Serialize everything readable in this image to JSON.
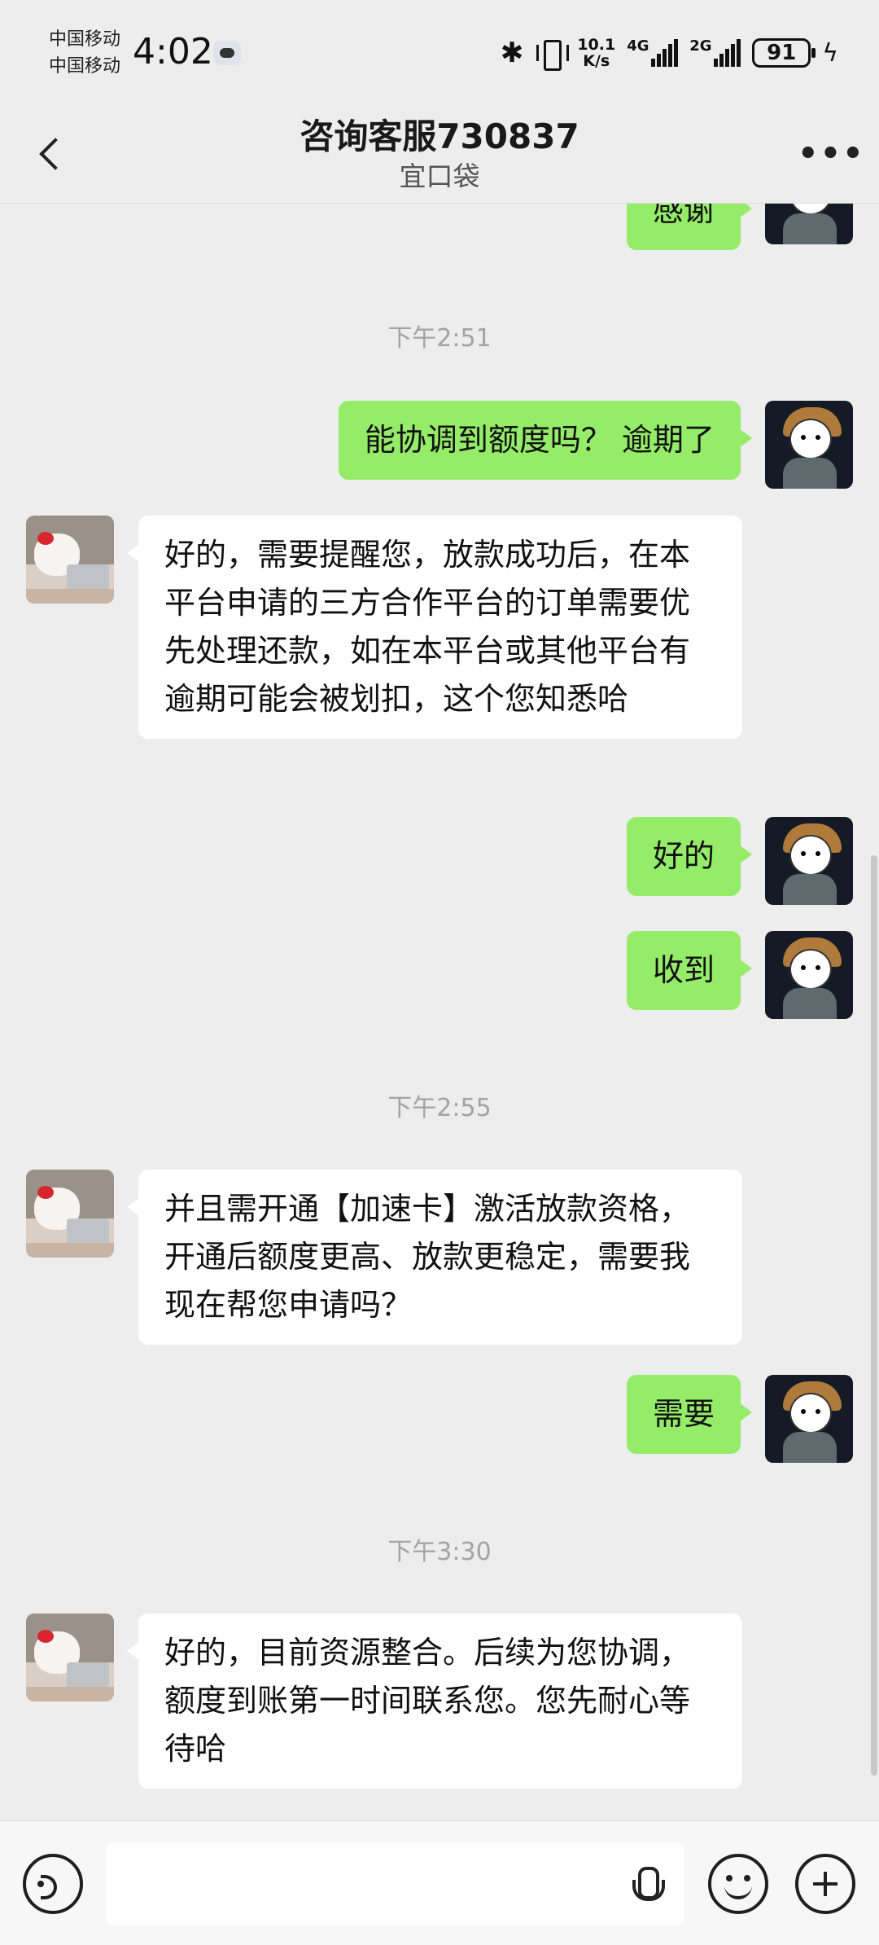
{
  "status_bar": {
    "carrier_1": "中国移动",
    "carrier_2": "中国移动",
    "time": "4:02",
    "net_speed_value": "10.1",
    "net_speed_unit": "K/s",
    "signal_1": "4G",
    "signal_2": "2G",
    "battery": "91",
    "icons": [
      "bluetooth-icon",
      "vibrate-icon",
      "signal-icon",
      "battery-icon",
      "charging-icon"
    ]
  },
  "header": {
    "title": "咨询客服730837",
    "subtitle": "宜口袋",
    "icons": [
      "back-icon",
      "more-icon"
    ]
  },
  "chat": {
    "partial_message": "感谢",
    "timestamps": [
      "下午2:51",
      "下午2:55",
      "下午3:30"
    ],
    "messages": [
      {
        "from": "self",
        "text": "能协调到额度吗？  逾期了"
      },
      {
        "from": "agent",
        "text": "好的，需要提醒您，放款成功后，在本平台申请的三方合作平台的订单需要优先处理还款，如在本平台或其他平台有逾期可能会被划扣，这个您知悉哈"
      },
      {
        "from": "self",
        "text": "好的"
      },
      {
        "from": "self",
        "text": "收到"
      },
      {
        "from": "agent",
        "text": "并且需开通【加速卡】激活放款资格，开通后额度更高、放款更稳定，需要我现在帮您申请吗？"
      },
      {
        "from": "self",
        "text": "需要"
      },
      {
        "from": "agent",
        "text": "好的，目前资源整合。后续为您协调，额度到账第一时间联系您。您先耐心等待哈"
      }
    ]
  },
  "input_bar": {
    "value": "",
    "placeholder": "",
    "icons": [
      "voice-icon",
      "mic-icon",
      "emoji-icon",
      "plus-icon"
    ]
  },
  "colors": {
    "background": "#ededed",
    "self_bubble": "#95ec69",
    "agent_bubble": "#ffffff",
    "timestamp": "#a3a3a3"
  }
}
